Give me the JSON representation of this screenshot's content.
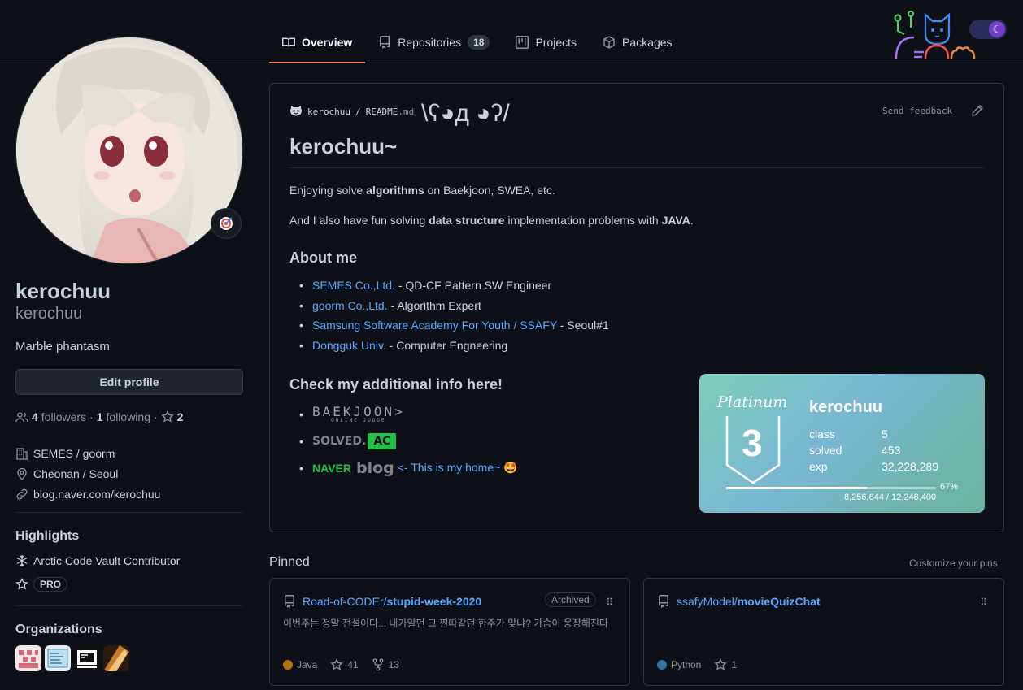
{
  "nav": {
    "tabs": [
      {
        "label": "Overview"
      },
      {
        "label": "Repositories",
        "count": "18"
      },
      {
        "label": "Projects"
      },
      {
        "label": "Packages"
      }
    ]
  },
  "theme": {
    "accent": "#f78166",
    "link": "#58a6ff",
    "background": "#0d1117"
  },
  "profile": {
    "fullname": "kerochuu",
    "username": "kerochuu",
    "bio": "Marble phantasm",
    "edit_label": "Edit profile",
    "followers_count": "4",
    "followers_label": "followers",
    "following_count": "1",
    "following_label": "following",
    "stars_count": "2",
    "company": "SEMES / goorm",
    "location": "Cheonan / Seoul",
    "website": "blog.naver.com/kerochuu"
  },
  "highlights": {
    "heading": "Highlights",
    "items": [
      "Arctic Code Vault Contributor",
      "PRO"
    ]
  },
  "organizations": {
    "heading": "Organizations"
  },
  "readme": {
    "owner": "kerochuu",
    "separator": "/",
    "file": "README",
    "ext": ".md",
    "feedback": "Send feedback",
    "title": "kerochuu~",
    "face": "\\ʕ◕д ◕ʔ/",
    "intro1_a": "Enjoying solve ",
    "intro1_b": "algorithms",
    "intro1_c": " on Baekjoon, SWEA, etc.",
    "intro2_a": "And I also have fun solving ",
    "intro2_b": "data structure",
    "intro2_c": " implementation problems with ",
    "intro2_d": "JAVA",
    "intro2_e": ".",
    "about_heading": "About me",
    "about": [
      {
        "link": "SEMES Co.,Ltd.",
        "rest": " - QD-CF Pattern SW Engineer"
      },
      {
        "link": "goorm Co.,Ltd.",
        "rest": " - Algorithm Expert"
      },
      {
        "link": "Samsung Software Academy For Youth / SSAFY",
        "rest": " - Seoul#1"
      },
      {
        "link": "Dongguk Univ.",
        "rest": " - Computer Engneering"
      }
    ],
    "info_heading": "Check my additional info here!",
    "baekjoon": "BAEKJOON>",
    "baekjoon_sub": "ONLINE JUDGE",
    "solved": "SOLVED.",
    "solved_ac": "AC",
    "naver": "NAVER",
    "blog": "blog",
    "home_link": "<- This is my home~ 🤩"
  },
  "solved_card": {
    "tier": "Platinum",
    "tier_num": "3",
    "handle": "kerochuu",
    "rows": [
      {
        "label": "class",
        "value": "5"
      },
      {
        "label": "solved",
        "value": "453"
      },
      {
        "label": "exp",
        "value": "32,228,289"
      }
    ],
    "progress": 0.67,
    "progress_label": "67%",
    "exp_progress": "8,256,644 / 12,248,400"
  },
  "pinned": {
    "heading": "Pinned",
    "customize": "Customize your pins",
    "repos": [
      {
        "owner": "Road-of-CODEr/",
        "name": "stupid-week-2020",
        "badge": "Archived",
        "desc": "이번주는 정말 전설이다... 내가알던 그 찐따같던 한주가 맞냐? 가슴이 웅장해진다",
        "language": "Java",
        "lang_color": "#b07219",
        "stars": "41",
        "forks": "13"
      },
      {
        "owner": "ssafyModel/",
        "name": "movieQuizChat",
        "language": "Python",
        "lang_color": "#3572A5",
        "stars": "1"
      }
    ]
  }
}
